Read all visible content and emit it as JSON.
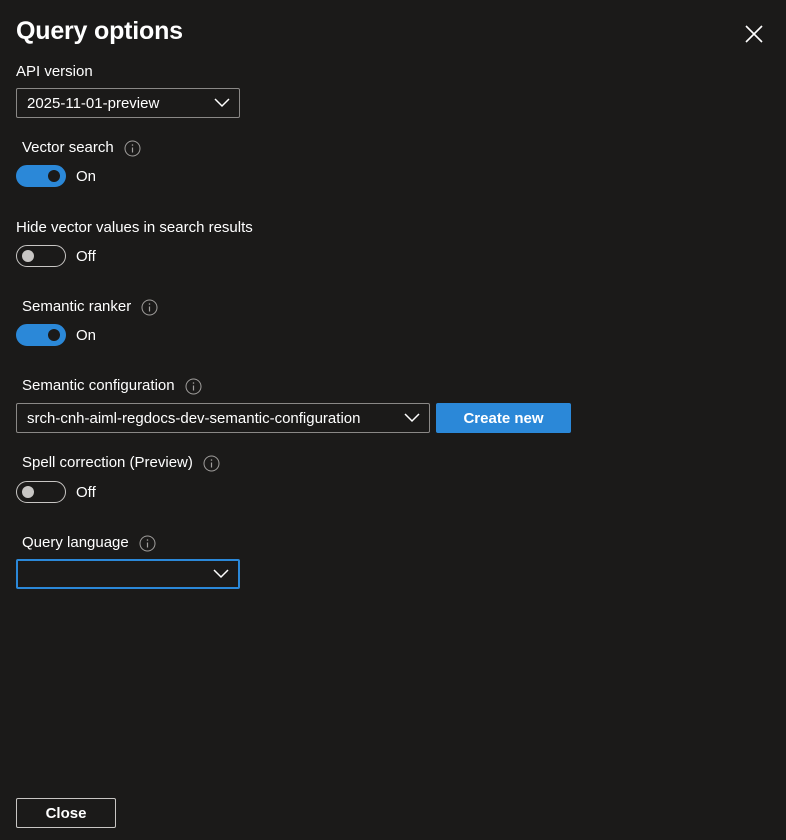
{
  "panel": {
    "title": "Query options",
    "close_icon": "close-icon"
  },
  "api_version": {
    "label": "API version",
    "value": "2025-11-01-preview"
  },
  "vector_search": {
    "label": "Vector search",
    "state_text": "On",
    "enabled": true
  },
  "hide_vector_values": {
    "label": "Hide vector values in search results",
    "state_text": "Off",
    "enabled": false
  },
  "semantic_ranker": {
    "label": "Semantic ranker",
    "state_text": "On",
    "enabled": true
  },
  "semantic_configuration": {
    "label": "Semantic configuration",
    "value": "srch-cnh-aiml-regdocs-dev-semantic-configuration",
    "create_new_label": "Create new"
  },
  "spell_correction": {
    "label": "Spell correction (Preview)",
    "state_text": "Off",
    "enabled": false
  },
  "query_language": {
    "label": "Query language",
    "value": ""
  },
  "footer": {
    "close_label": "Close"
  },
  "colors": {
    "background": "#1b1a19",
    "accent": "#2b88d8",
    "border": "#8a8886",
    "text": "#ffffff"
  }
}
